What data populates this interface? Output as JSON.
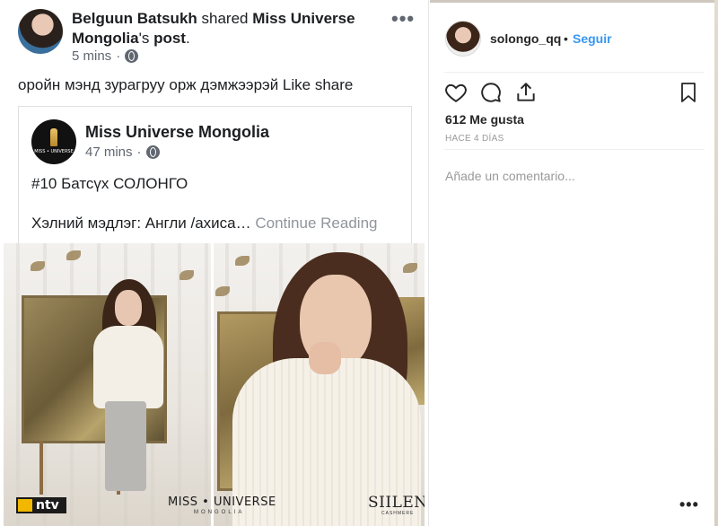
{
  "facebook": {
    "sharer_name": "Belguun Batsukh",
    "shared_word": " shared ",
    "source_page": "Miss Universe Mongolia",
    "possessive": "'s ",
    "post_word": "post",
    "period": ".",
    "time": "5 mins",
    "separator": "·",
    "more": "•••",
    "message": "оройн мэнд зурагруу орж дэмжээрэй Like share",
    "shared_post": {
      "page_name": "Miss Universe Mongolia",
      "time": "47 mins",
      "separator": "·",
      "line1": "#10 Батсүх СОЛОНГО",
      "line2": "Хэлний мэдлэг: Англи /ахиса…",
      "continue": "Continue Reading",
      "avatar_text": "MISS • UNIVERSE"
    },
    "photo_logos": {
      "ntv": "ntv",
      "miss_universe": "MISS • UNIVERSE",
      "miss_universe_sub": "MONGOLIA",
      "silen": "SIILEN",
      "silen_sub": "CASHMERE"
    }
  },
  "instagram": {
    "username": "solongo_qq",
    "dot": "•",
    "follow": "Seguir",
    "likes": "612 Me gusta",
    "time_ago": "HACE 4 DÍAS",
    "comment_placeholder": "Añade un comentario...",
    "more": "•••"
  },
  "colors": {
    "facebook_text": "#1c1e21",
    "facebook_meta": "#606770",
    "instagram_link": "#3897f0",
    "instagram_muted": "#999999"
  },
  "icons": [
    "globe-icon",
    "heart-icon",
    "comment-icon",
    "share-icon",
    "bookmark-icon",
    "more-icon"
  ]
}
